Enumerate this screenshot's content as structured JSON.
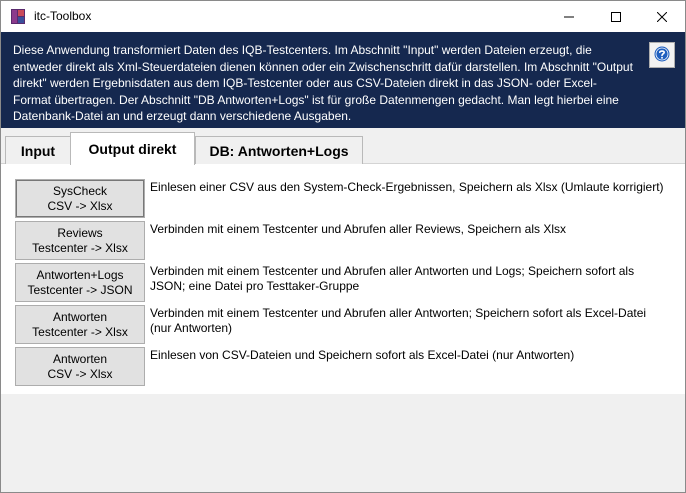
{
  "window": {
    "title": "itc-Toolbox"
  },
  "banner": {
    "text": "Diese Anwendung transformiert Daten des IQB-Testcenters. Im Abschnitt \"Input\" werden Dateien erzeugt, die entweder direkt als Xml-Steuerdateien dienen können oder ein Zwischenschritt dafür darstellen. Im Abschnitt \"Output direkt\" werden Ergebnisdaten aus dem IQB-Testcenter oder aus CSV-Dateien direkt in das JSON- oder Excel-Format übertragen. Der Abschnitt \"DB Antworten+Logs\" ist für große Datenmengen gedacht. Man legt hierbei eine Datenbank-Datei an und erzeugt dann verschiedene Ausgaben."
  },
  "tabs": [
    {
      "label": "Input"
    },
    {
      "label": "Output direkt"
    },
    {
      "label": "DB: Antworten+Logs"
    }
  ],
  "actions": [
    {
      "line1": "SysCheck",
      "line2": "CSV -> Xlsx",
      "description": "Einlesen einer CSV aus den System-Check-Ergebnissen, Speichern als Xlsx (Umlaute korrigiert)"
    },
    {
      "line1": "Reviews",
      "line2": "Testcenter -> Xlsx",
      "description": "Verbinden mit einem Testcenter und Abrufen aller Reviews, Speichern als Xlsx"
    },
    {
      "line1": "Antworten+Logs",
      "line2": "Testcenter -> JSON",
      "description": "Verbinden mit einem Testcenter und Abrufen aller Antworten und Logs; Speichern sofort als JSON; eine Datei pro Testtaker-Gruppe"
    },
    {
      "line1": "Antworten",
      "line2": "Testcenter -> Xlsx",
      "description": "Verbinden mit einem Testcenter und Abrufen aller Antworten; Speichern sofort als Excel-Datei (nur Antworten)"
    },
    {
      "line1": "Antworten",
      "line2": "CSV -> Xlsx",
      "description": "Einlesen von CSV-Dateien und Speichern sofort als Excel-Datei (nur Antworten)"
    }
  ],
  "colors": {
    "banner_bg": "#15284f",
    "help_icon": "#1f5fbf"
  }
}
